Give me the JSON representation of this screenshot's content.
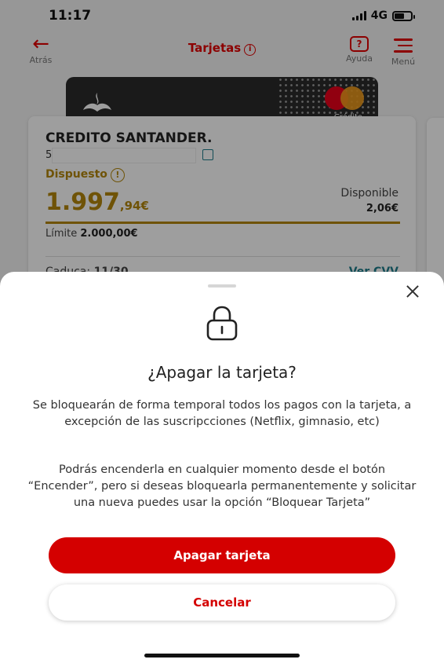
{
  "status_bar": {
    "time": "11:17",
    "network": "4G"
  },
  "nav": {
    "back_label": "Atrás",
    "title": "Tarjetas",
    "help_label": "Ayuda",
    "menu_label": "Menú",
    "accent_color": "#e20000"
  },
  "card_image": {
    "type_label": "Crédito"
  },
  "card": {
    "name": "CREDITO SANTANDER.",
    "number_prefix": "5",
    "spent_label": "Dispuesto",
    "spent_int": "1.997",
    "spent_dec": ",94€",
    "available_label": "Disponible",
    "available_value": "2,06€",
    "limit_label": "Límite",
    "limit_value": "2.000,00€",
    "expiry_label": "Caduca:",
    "expiry_value": "11/30",
    "cvv_link": "Ver CVV"
  },
  "sheet": {
    "title": "¿Apagar la tarjeta?",
    "paragraph_1": "Se bloquearán de forma temporal todos los pagos con la tarjeta, a excepción de las suscripcciones (Netflix, gimnasio, etc)",
    "paragraph_2": "Podrás encenderla en cualquier momento desde el botón “Encender”, pero si deseas bloquearla permanentemente y solicitar una nueva puedes usar la opción “Bloquear Tarjeta”",
    "primary_button": "Apagar tarjeta",
    "secondary_button": "Cancelar",
    "primary_color": "#d40000"
  },
  "icons": {
    "lock": "lock-icon",
    "close": "close-icon",
    "back": "arrow-left-icon",
    "help": "help-chat-icon",
    "menu": "hamburger-menu-icon"
  }
}
